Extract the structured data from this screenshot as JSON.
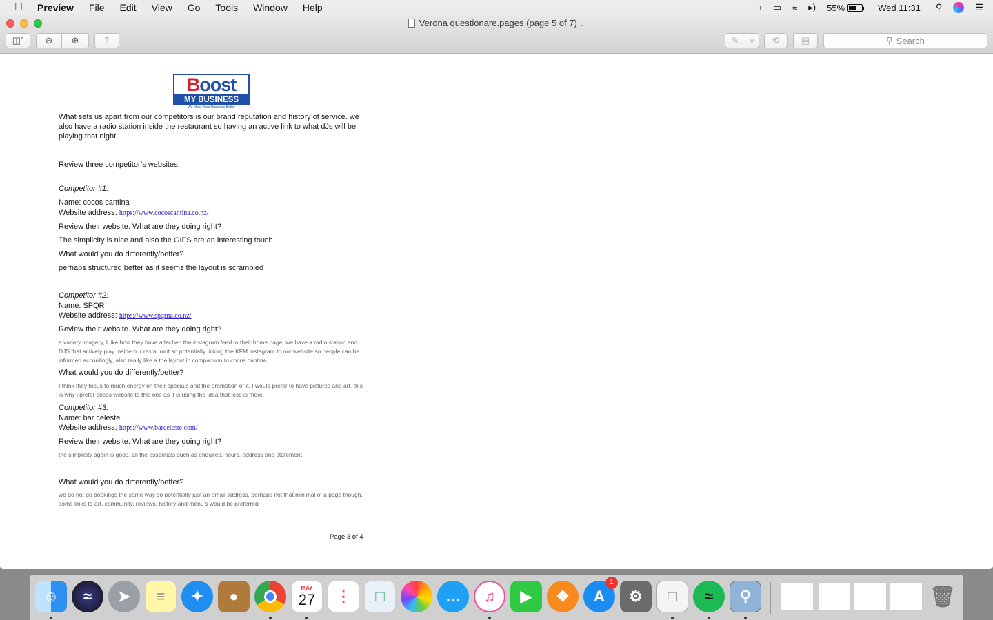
{
  "menubar": {
    "app_name": "Preview",
    "menus": [
      "File",
      "Edit",
      "View",
      "Go",
      "Tools",
      "Window",
      "Help"
    ],
    "battery_percent": "55%",
    "clock": "Wed 11:31"
  },
  "window": {
    "title": "Verona questionare.pages (page 5 of 7)",
    "search_placeholder": "Search"
  },
  "document": {
    "logo": {
      "word": "Boost",
      "bar": "MY BUSINESS",
      "tagline": "We Make Your Business Better"
    },
    "intro": "What sets us apart from our competitors is our brand reputation and history of service. we also have a radio station inside the restaurant so having an active link to what dJs will be playing that night.",
    "review_heading": "Review three competitor’s websites:",
    "competitors": [
      {
        "heading": "Competitor #1:",
        "name": "Name: cocos cantina",
        "website_label": "Website address: ",
        "website": "https://www.cocoscantina.co.nz/",
        "q1": "Review their website.  What are they doing right?",
        "a1": "The simplicity is nice and also the GIFS are an interesting touch",
        "q2": "What would you do differently/better?",
        "a2": "perhaps structured better as it seems the layout is scrambled"
      },
      {
        "heading": "Competitor #2:",
        "name": "Name: SPQR",
        "website_label": "Website address: ",
        "website": "https://www.spqrnz.co.nz/",
        "q1": "Review their website.  What are they doing right?",
        "a1": "a variety imagery, I like how they have attached the instagram feed to their home page, we have a radio station and DJS that actively play inside our restaurant so potentially linking the KFM instagram to our website so people can be informed accordingly, also really like a the layout in comparison to cocos cantina",
        "q2": "What would you do differently/better?",
        "a2": "I think they focus to much energy on their specials and the promotion of it. I would prefer to have pictures and art. this is why i prefer cocos website to this one as it is using the idea that less is more."
      },
      {
        "heading": "Competitor #3:",
        "name": "Name: bar celeste",
        "website_label": "Website address: ",
        "website": "https://www.barceleste.com/",
        "q1": "Review their website.  What are they doing right?",
        "a1": "the simplicity again is good, all the essentials such as enquires, hours, address and statement.",
        "q2": "What would you do differently/better?",
        "a2": "we do not do bookings the same way so potentially just an email address, perhaps not that minimal of a page though, some links to art, community, reviews, history and menu’s would be preferred"
      }
    ],
    "footer": "Page 3 of 4"
  },
  "dock": {
    "calendar_month": "MAY",
    "calendar_day": "27",
    "app_store_badge": "1"
  }
}
